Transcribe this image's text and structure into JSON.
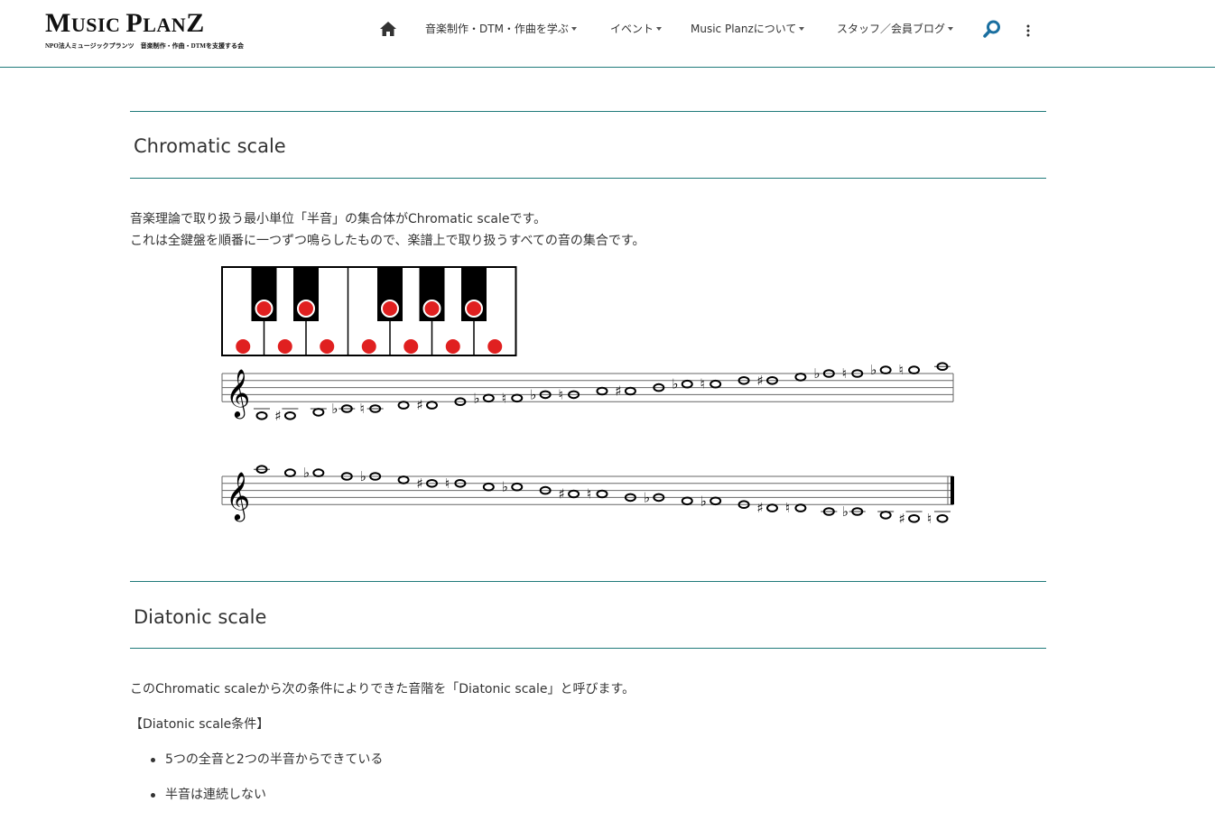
{
  "header": {
    "logo_text_1": "M",
    "logo_text_2": "USIC ",
    "logo_text_3": "P",
    "logo_text_4": "LAN",
    "logo_text_5": "Z",
    "logo_subtitle": "NPO法人ミュージックプランツ　音楽制作・作曲・DTMを支援する会",
    "nav": [
      {
        "label": "音楽制作・DTM・作曲を学ぶ"
      },
      {
        "label": "イベント"
      },
      {
        "label": "Music Planzについて"
      },
      {
        "label": "スタッフ／会員ブログ"
      }
    ],
    "icons": {
      "home": "home-icon",
      "search": "search-icon",
      "more": "kebab-icon"
    },
    "accent_color": "#1f7a7a"
  },
  "sections": [
    {
      "title": "Chromatic scale",
      "paragraph_1": "音楽理論で取り扱う最小単位「半音」の集合体がChromatic scaleです。",
      "paragraph_2": "これは全鍵盤を順番に一つずつ鳴らしたもので、楽譜上で取り扱うすべての音の集合です。"
    },
    {
      "title": "Diatonic scale",
      "paragraph_1": "このChromatic scaleから次の条件によりできた音階を「Diatonic scale」と呼びます。",
      "paragraph_2": "【Diatonic scale条件】",
      "bullets": [
        "5つの全音と2つの半音からできている",
        "半音は連続しない"
      ]
    }
  ],
  "figure": {
    "keyboard_white_keys": 7,
    "keyboard_black_keys": 5,
    "note_dot_color": "#e02020",
    "ascending_accidentals": [
      "",
      "♯",
      "",
      "♭",
      "♮",
      "",
      "♯",
      "",
      "♭",
      "♮",
      "♭",
      "♮",
      "",
      "♯",
      "",
      "♭",
      "♮",
      "",
      "♯",
      "",
      "♭",
      "♮",
      "♭",
      "♮",
      ""
    ],
    "descending_accidentals": [
      "",
      "",
      "♭",
      "",
      "♭",
      "",
      "♯",
      "♮",
      "",
      "♭",
      "",
      "♯",
      "♮",
      "",
      "♭",
      "",
      "♭",
      "",
      "♯",
      "♮",
      "",
      "♭",
      "",
      "♯",
      "♮"
    ]
  }
}
